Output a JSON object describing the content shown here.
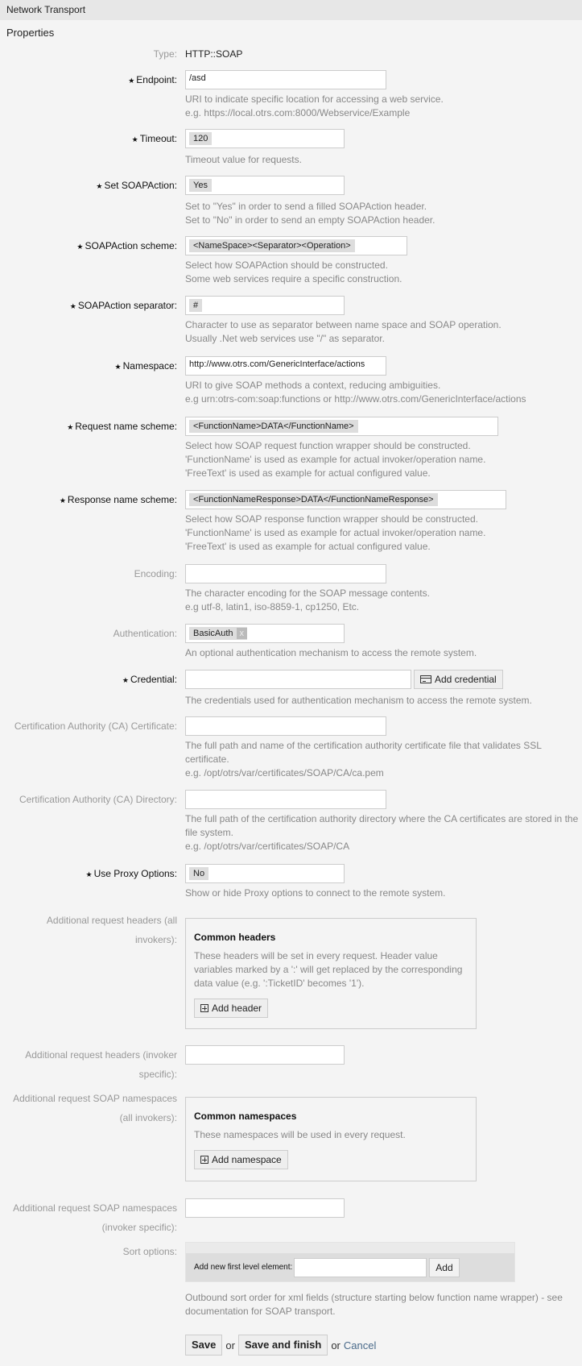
{
  "header": {
    "title": "Network Transport"
  },
  "section": {
    "title": "Properties"
  },
  "fields": {
    "type": {
      "label": "Type:",
      "value": "HTTP::SOAP"
    },
    "endpoint": {
      "label": "Endpoint:",
      "value": "/asd",
      "help": [
        "URI to indicate specific location for accessing a web service.",
        "e.g. https://local.otrs.com:8000/Webservice/Example"
      ]
    },
    "timeout": {
      "label": "Timeout:",
      "value": "120",
      "help": [
        "Timeout value for requests."
      ]
    },
    "set_soapaction": {
      "label": "Set SOAPAction:",
      "value": "Yes",
      "help": [
        "Set to \"Yes\" in order to send a filled SOAPAction header.",
        "Set to \"No\" in order to send an empty SOAPAction header."
      ]
    },
    "soapaction_scheme": {
      "label": "SOAPAction scheme:",
      "value": "<NameSpace><Separator><Operation>",
      "help": [
        "Select how SOAPAction should be constructed.",
        "Some web services require a specific construction."
      ]
    },
    "soapaction_separator": {
      "label": "SOAPAction separator:",
      "value": "#",
      "help": [
        "Character to use as separator between name space and SOAP operation.",
        "Usually .Net web services use \"/\" as separator."
      ]
    },
    "namespace": {
      "label": "Namespace:",
      "value": "http://www.otrs.com/GenericInterface/actions",
      "help": [
        "URI to give SOAP methods a context, reducing ambiguities.",
        "e.g urn:otrs-com:soap:functions or http://www.otrs.com/GenericInterface/actions"
      ]
    },
    "request_name_scheme": {
      "label": "Request name scheme:",
      "value": "<FunctionName>DATA</FunctionName>",
      "help": [
        "Select how SOAP request function wrapper should be constructed.",
        "'FunctionName' is used as example for actual invoker/operation name.",
        "'FreeText' is used as example for actual configured value."
      ]
    },
    "response_name_scheme": {
      "label": "Response name scheme:",
      "value": "<FunctionNameResponse>DATA</FunctionNameResponse>",
      "help": [
        "Select how SOAP response function wrapper should be constructed.",
        "'FunctionName' is used as example for actual invoker/operation name.",
        "'FreeText' is used as example for actual configured value."
      ]
    },
    "encoding": {
      "label": "Encoding:",
      "value": "",
      "help": [
        "The character encoding for the SOAP message contents.",
        "e.g utf-8, latin1, iso-8859-1, cp1250, Etc."
      ]
    },
    "authentication": {
      "label": "Authentication:",
      "value": "BasicAuth",
      "remove": "x",
      "help": [
        "An optional authentication mechanism to access the remote system."
      ]
    },
    "credential": {
      "label": "Credential:",
      "value": "",
      "button": "Add credential",
      "help": [
        "The credentials used for authentication mechanism to access the remote system."
      ]
    },
    "ca_certificate": {
      "label": "Certification Authority (CA) Certificate:",
      "value": "",
      "help": [
        "The full path and name of the certification authority certificate file that validates SSL certificate.",
        "e.g. /opt/otrs/var/certificates/SOAP/CA/ca.pem"
      ]
    },
    "ca_directory": {
      "label": "Certification Authority (CA) Directory:",
      "value": "",
      "help": [
        "The full path of the certification authority directory where the CA certificates are stored in the file system.",
        "e.g. /opt/otrs/var/certificates/SOAP/CA"
      ]
    },
    "use_proxy": {
      "label": "Use Proxy Options:",
      "value": "No",
      "help": [
        "Show or hide Proxy options to connect to the remote system."
      ]
    },
    "headers_all": {
      "label": "Additional request headers (all invokers):",
      "box_title": "Common headers",
      "box_text": "These headers will be set in every request. Header value variables marked by a ':' will get replaced by the corresponding data value (e.g. ':TicketID' becomes '1').",
      "button": "Add header"
    },
    "headers_invoker": {
      "label": "Additional request headers (invoker specific):",
      "value": ""
    },
    "namespaces_all": {
      "label": "Additional request SOAP namespaces (all invokers):",
      "box_title": "Common namespaces",
      "box_text": "These namespaces will be used in every request.",
      "button": "Add namespace"
    },
    "namespaces_invoker": {
      "label": "Additional request SOAP namespaces (invoker specific):",
      "value": ""
    },
    "sort_options": {
      "label": "Sort options:",
      "add_label": "Add new first level element:",
      "value": "",
      "button": "Add",
      "help": "Outbound sort order for xml fields (structure starting below function name wrapper) - see documentation for SOAP transport."
    }
  },
  "actions": {
    "save": "Save",
    "or1": "or",
    "save_finish": "Save and finish",
    "or2": "or",
    "cancel": "Cancel"
  },
  "required_marker": "★"
}
